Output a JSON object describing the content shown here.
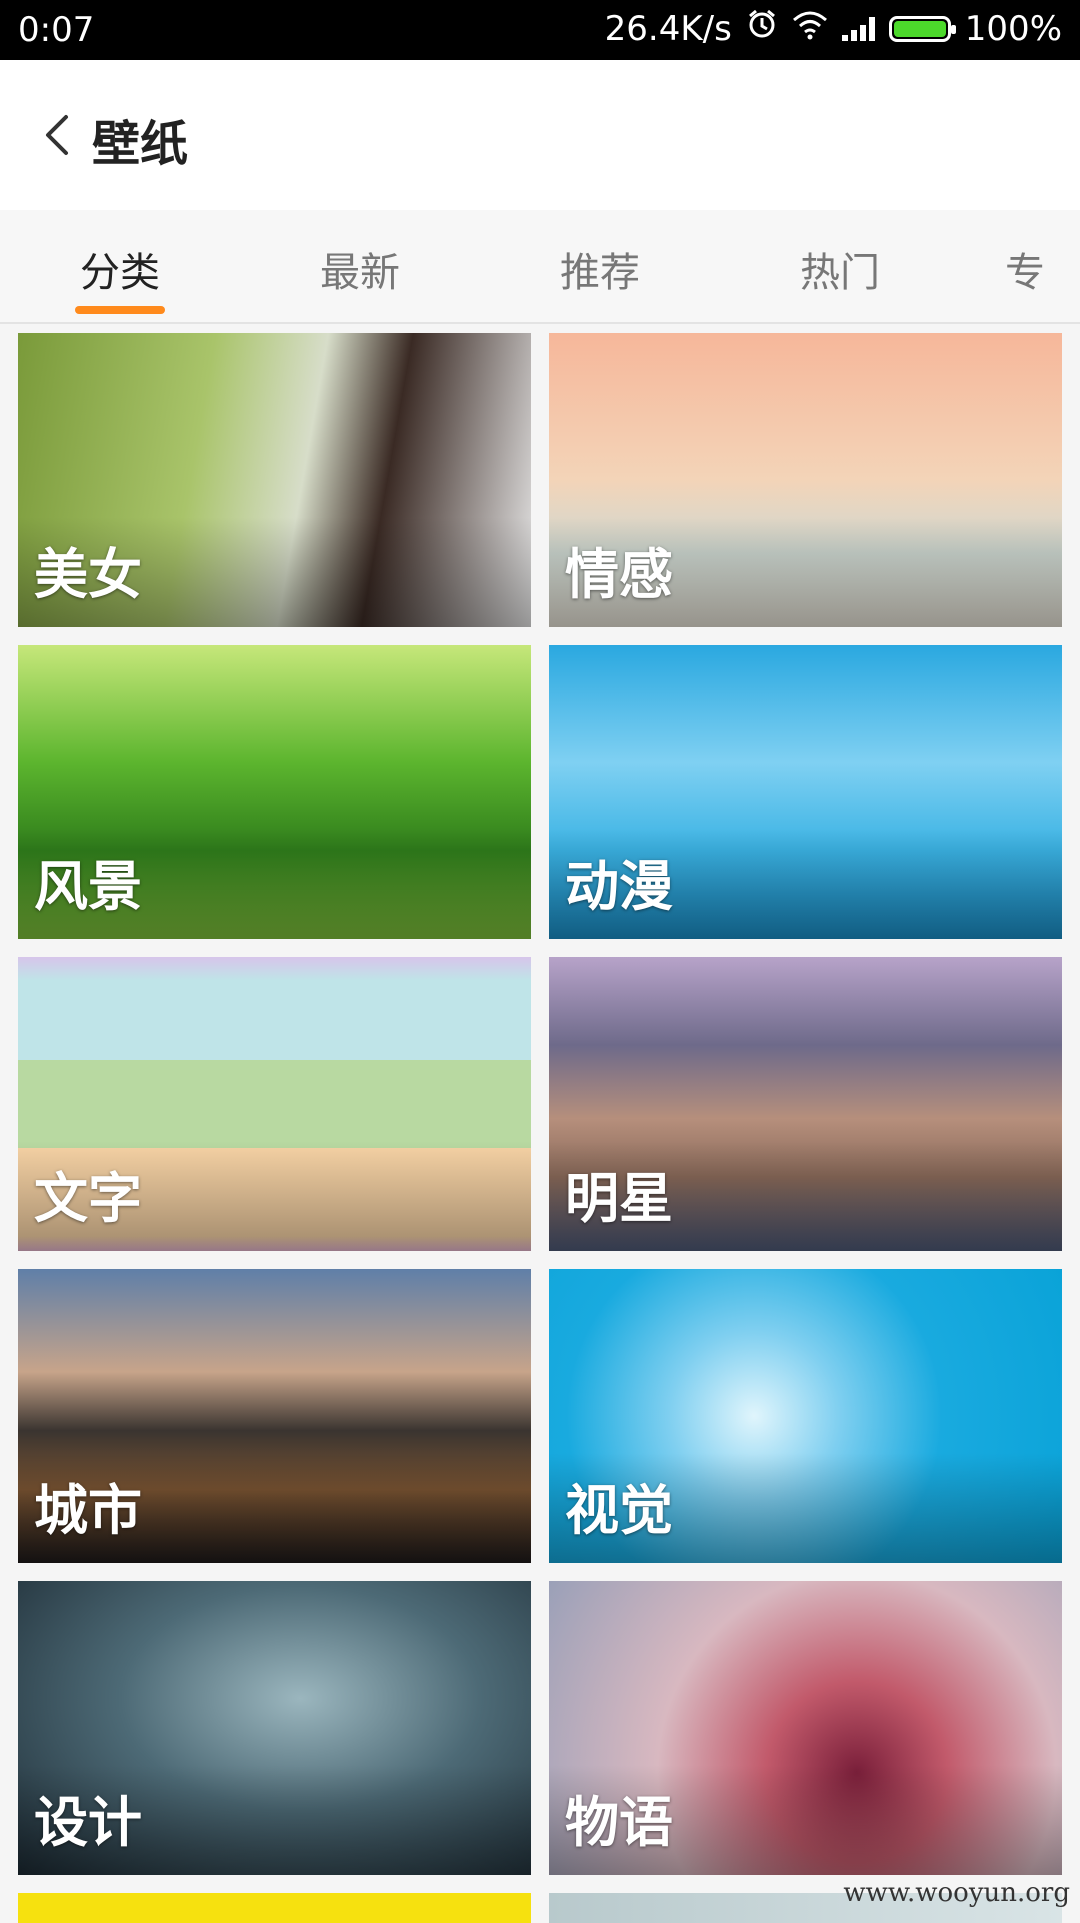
{
  "status_bar": {
    "time": "0:07",
    "speed": "26.4K/s",
    "battery": "100%",
    "icons": [
      "alarm-icon",
      "wifi-icon",
      "signal-icon",
      "battery-icon"
    ]
  },
  "header": {
    "title": "壁纸",
    "back_icon": "chevron-left-icon"
  },
  "tabs": [
    {
      "label": "分类",
      "active": true
    },
    {
      "label": "最新",
      "active": false
    },
    {
      "label": "推荐",
      "active": false
    },
    {
      "label": "热门",
      "active": false
    },
    {
      "label": "专",
      "active": false
    }
  ],
  "accent_color": "#ff8a1c",
  "categories": [
    {
      "label": "美女"
    },
    {
      "label": "情感"
    },
    {
      "label": "风景"
    },
    {
      "label": "动漫"
    },
    {
      "label": "文字"
    },
    {
      "label": "明星"
    },
    {
      "label": "城市"
    },
    {
      "label": "视觉"
    },
    {
      "label": "设计"
    },
    {
      "label": "物语"
    }
  ],
  "watermark": "www.wooyun.org"
}
